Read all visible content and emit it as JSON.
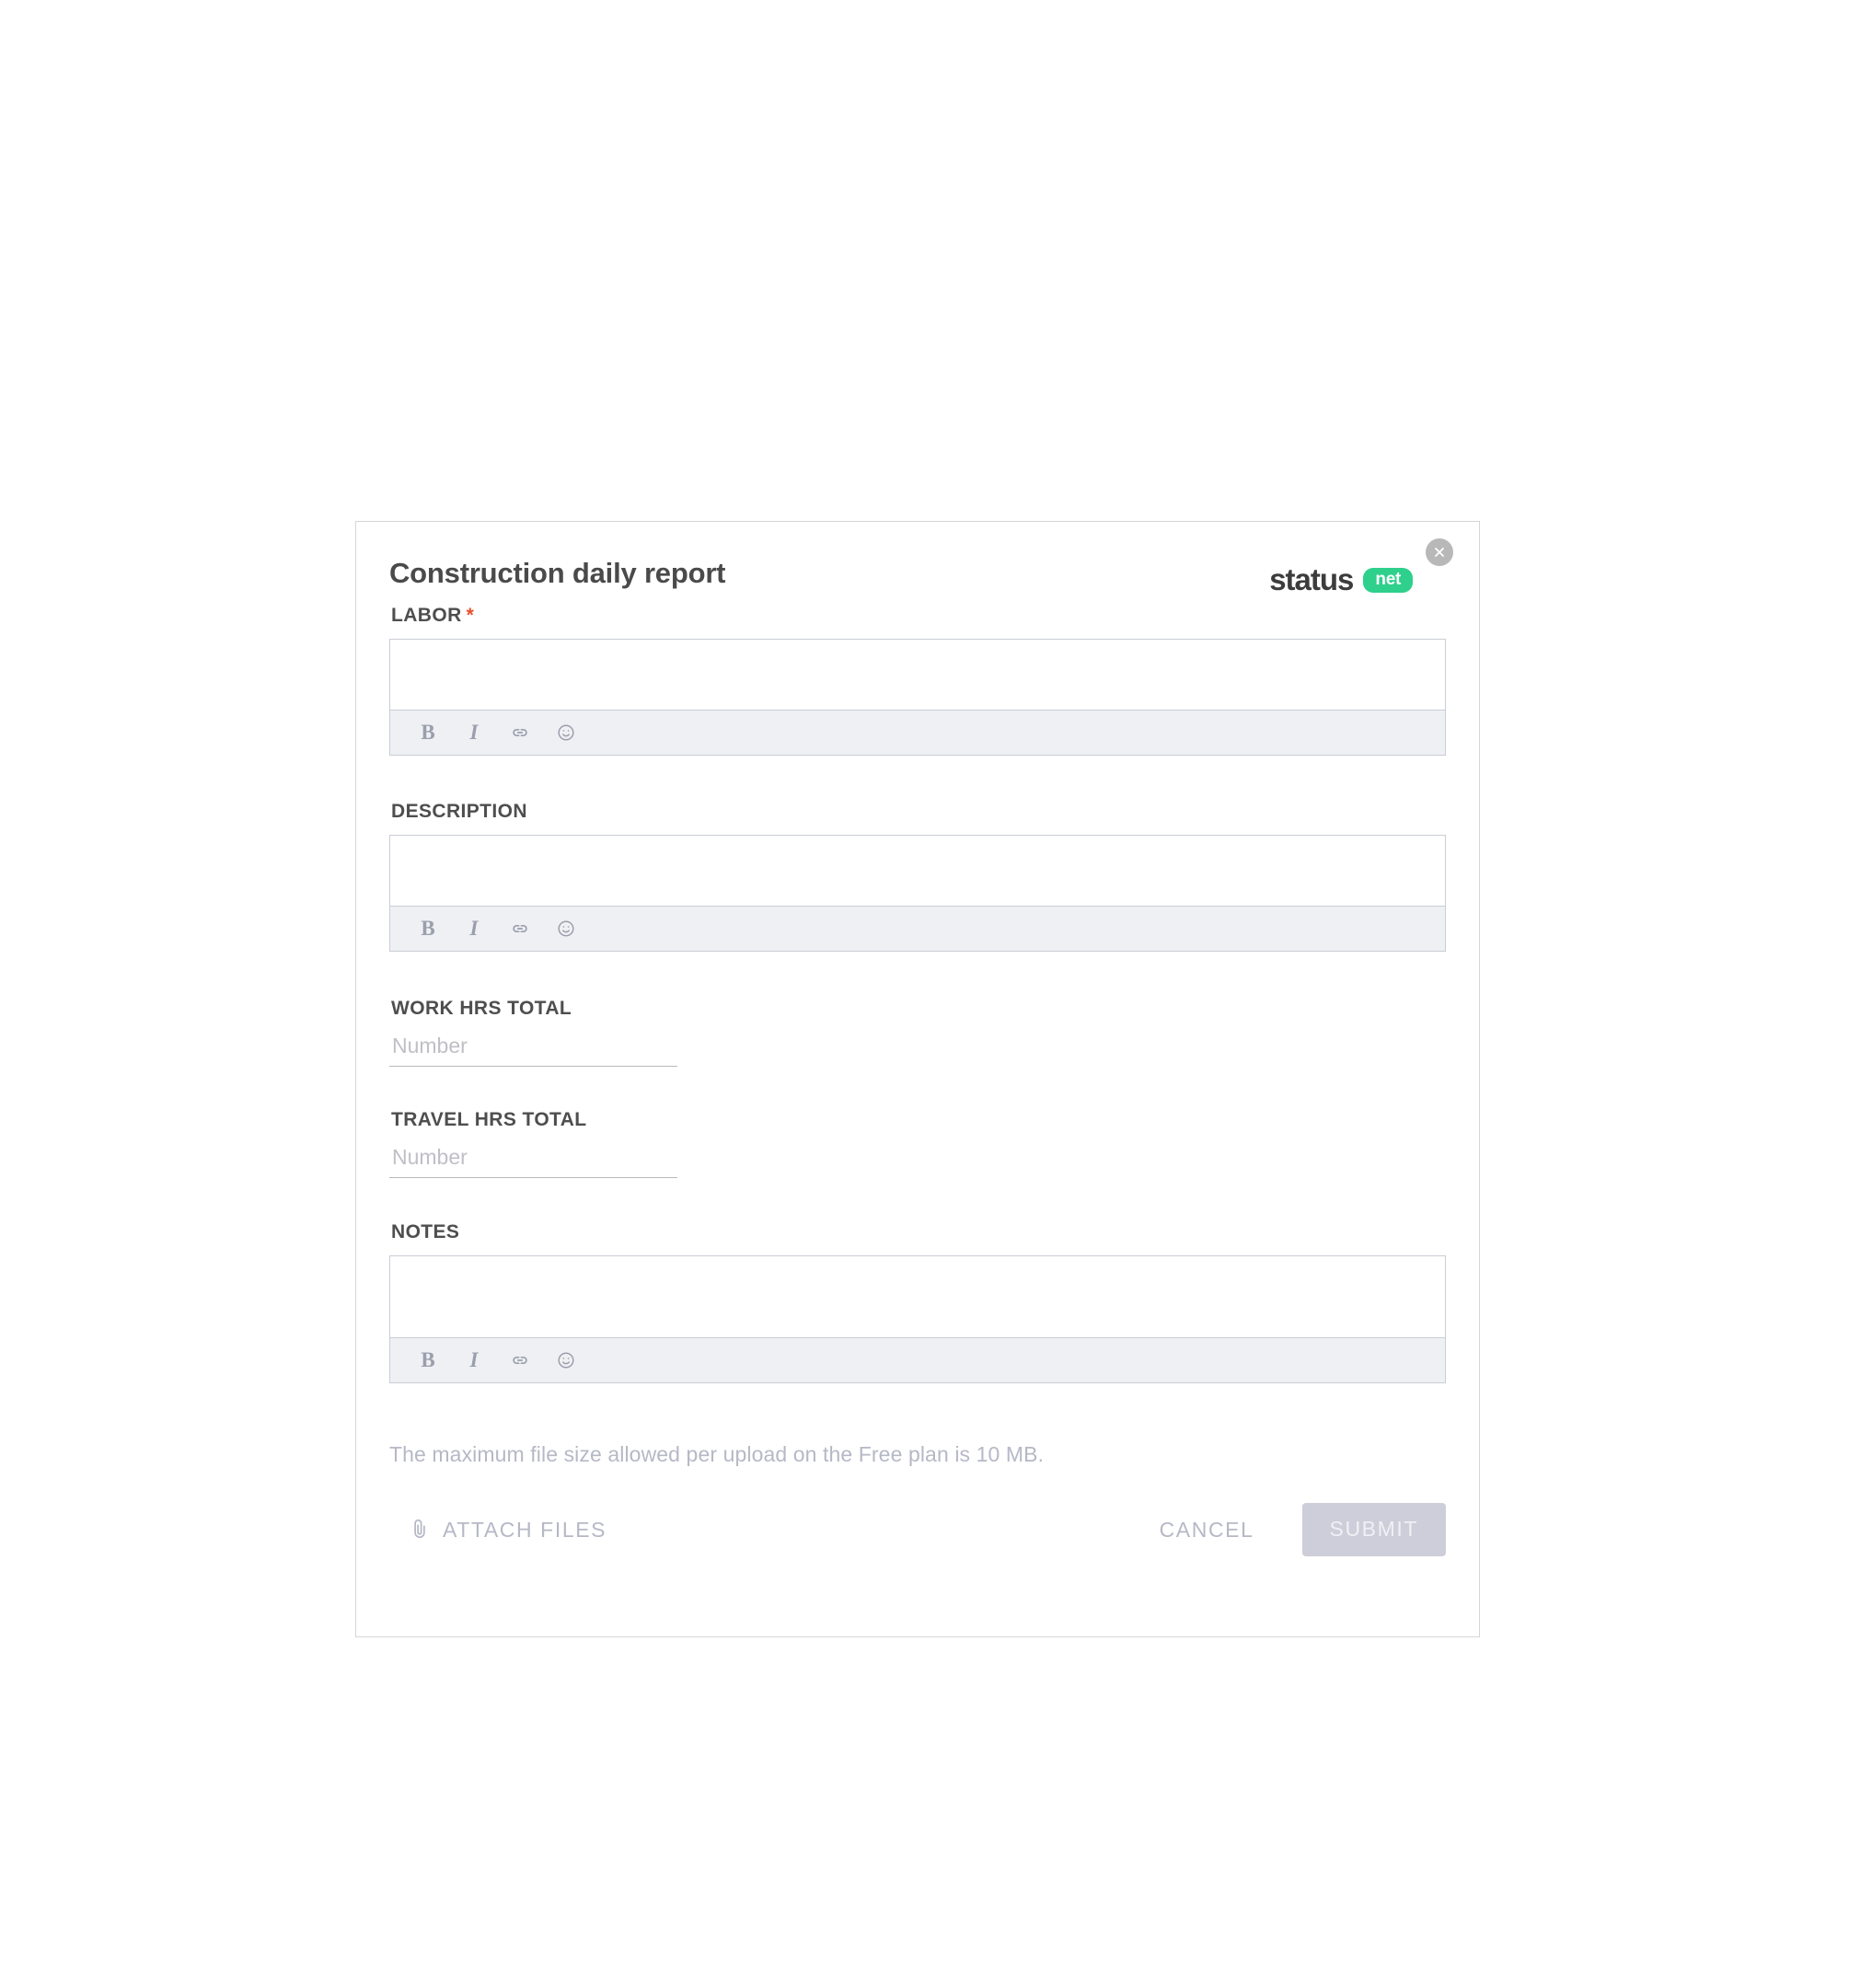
{
  "dialog": {
    "title": "Construction daily report",
    "close_icon": "close-icon"
  },
  "brand": {
    "word": "status",
    "pill": "net",
    "pill_color": "#2ed08b"
  },
  "fields": {
    "labor": {
      "label": "LABOR",
      "required_marker": "*",
      "required": true,
      "value": "",
      "type": "rich-text"
    },
    "description": {
      "label": "DESCRIPTION",
      "value": "",
      "type": "rich-text"
    },
    "work_hrs_total": {
      "label": "WORK HRS TOTAL",
      "value": "",
      "placeholder": "Number",
      "type": "number"
    },
    "travel_hrs_total": {
      "label": "TRAVEL HRS TOTAL",
      "value": "",
      "placeholder": "Number",
      "type": "number"
    },
    "notes": {
      "label": "NOTES",
      "value": "",
      "type": "rich-text"
    }
  },
  "toolbar": {
    "bold_label": "B",
    "italic_label": "I",
    "icons": [
      "bold-icon",
      "italic-icon",
      "link-icon",
      "emoji-icon"
    ]
  },
  "footer": {
    "file_note": "The maximum file size allowed per upload on the Free plan is 10 MB.",
    "attach_label": "ATTACH FILES",
    "attach_icon": "paperclip-icon",
    "cancel_label": "CANCEL",
    "submit_label": "SUBMIT",
    "submit_disabled": true
  },
  "colors": {
    "required_star": "#e8502a",
    "accent_green": "#2ed08b",
    "label_text": "#4e4e4e",
    "muted_text": "#b6b8c6",
    "submit_bg": "#cdced9"
  }
}
